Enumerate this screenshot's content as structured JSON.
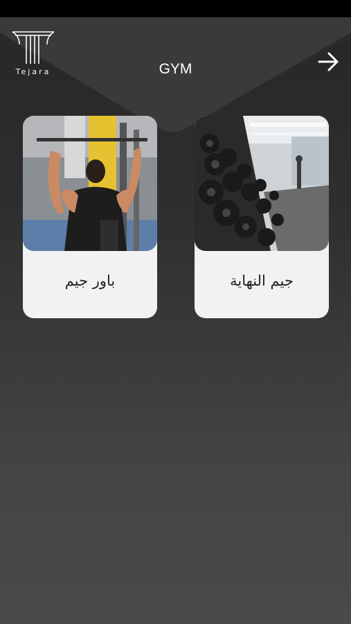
{
  "app": {
    "logo_text": "Tejara",
    "title": "GYM"
  },
  "icons": {
    "back": "arrow-right-icon",
    "logo": "tejara-logo"
  },
  "cards": [
    {
      "label": "جيم النهاية",
      "image": "dumbbell-rack-photo"
    },
    {
      "label": "باور جيم",
      "image": "lat-pulldown-photo"
    }
  ]
}
